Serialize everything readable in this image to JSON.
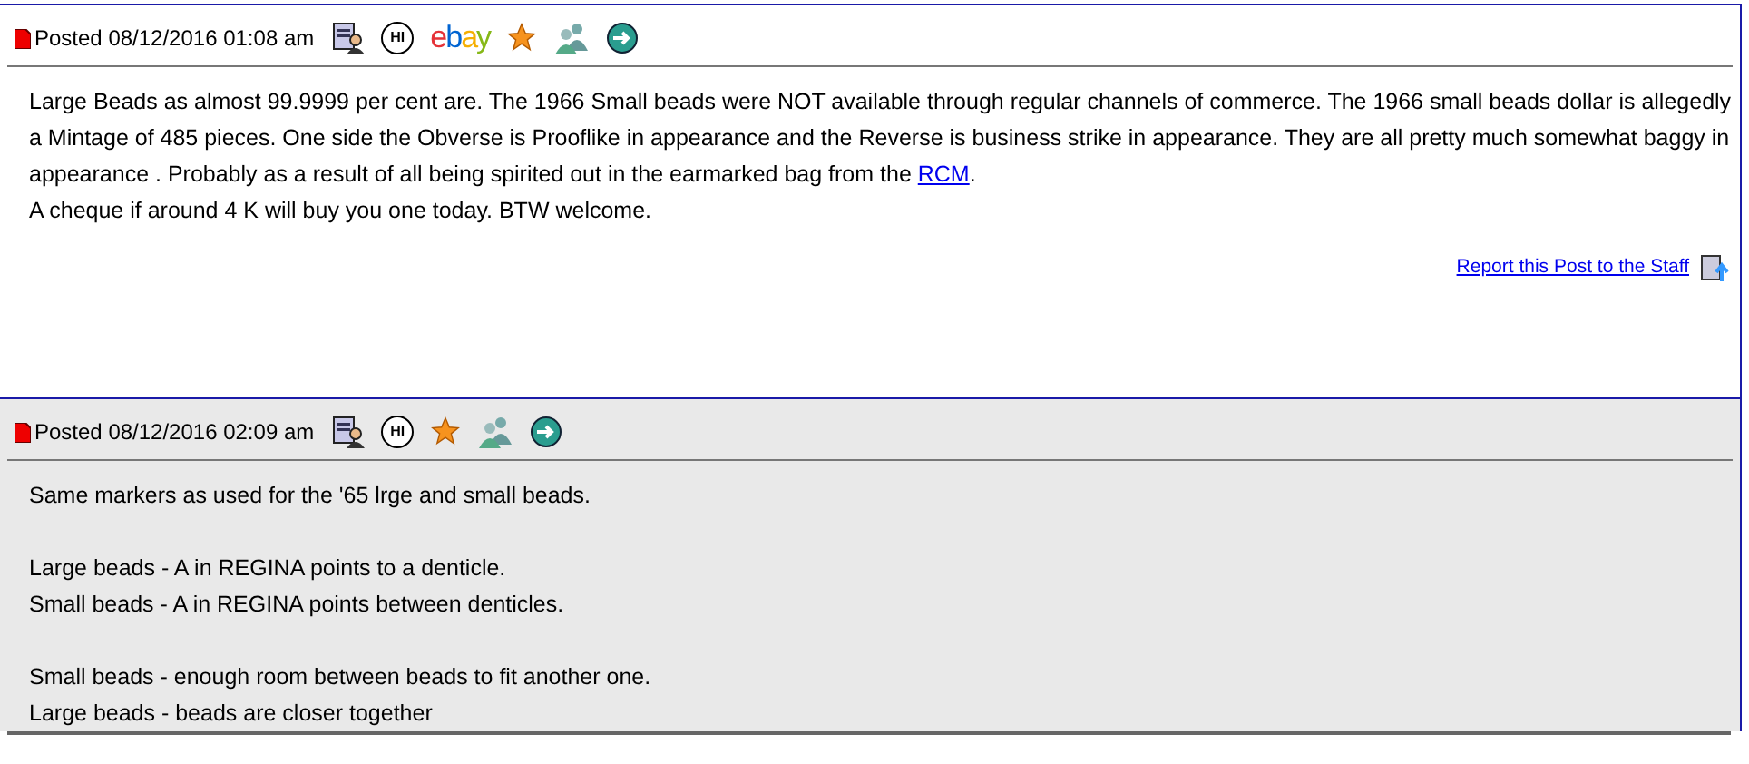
{
  "posts": [
    {
      "posted": "Posted 08/12/2016  01:08 am",
      "shaded": false,
      "icons": [
        {
          "kind": "profile"
        },
        {
          "kind": "message",
          "text": "HI"
        },
        {
          "kind": "ebay",
          "text": "ebay"
        },
        {
          "kind": "star"
        },
        {
          "kind": "users"
        },
        {
          "kind": "web"
        }
      ],
      "paragraphs": [
        [
          {
            "text": "Large Beads as almost 99.9999 per cent are. The 1966 Small beads were NOT available through regular channels of commerce. The 1966 small beads dollar is allegedly a Mintage of 485 pieces. One side the Obverse is Prooflike in appearance and the Reverse is business strike in appearance. They are all pretty much somewhat baggy in appearance . Probably as a result of all being spirited out in the earmarked bag from the ",
            "link": "RCM",
            "after": "."
          },
          {
            "text": "A cheque if around 4 K will buy you one today. BTW welcome."
          }
        ]
      ],
      "report": "Report this Post to the Staff"
    },
    {
      "posted": "Posted 08/12/2016  02:09 am",
      "shaded": true,
      "icons": [
        {
          "kind": "profile"
        },
        {
          "kind": "message",
          "text": "HI"
        },
        {
          "kind": "star"
        },
        {
          "kind": "users"
        },
        {
          "kind": "web"
        }
      ],
      "paragraphs": [
        [
          {
            "text": "Same markers as used for the '65 lrge and small beads."
          }
        ],
        [
          {
            "text": "Large beads - A in REGINA points to a denticle."
          },
          {
            "text": "Small beads - A in REGINA points between denticles."
          }
        ],
        [
          {
            "text": "Small beads - enough room between beads to fit another one."
          },
          {
            "text": "Large beads - beads are closer together"
          }
        ]
      ]
    }
  ]
}
